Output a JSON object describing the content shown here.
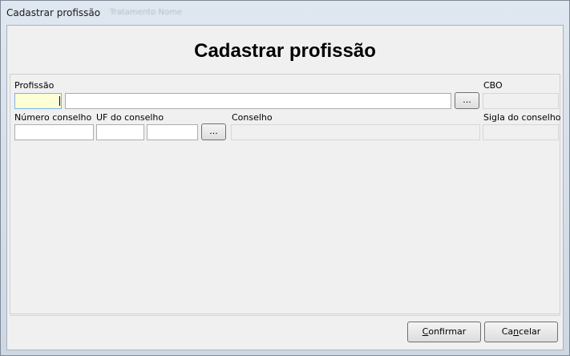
{
  "window": {
    "title": "Cadastrar profissão",
    "ghost_title": "Tratamento Nome"
  },
  "form": {
    "heading": "Cadastrar profissão",
    "profissao_label": "Profissão",
    "cbo_label": "CBO",
    "numero_conselho_label": "Número conselho",
    "uf_conselho_label": "UF do conselho",
    "conselho_label": "Conselho",
    "sigla_conselho_label": "Sigla do conselho",
    "lookup_button": "...",
    "profissao_code": "",
    "profissao_name": "",
    "cbo_value": "",
    "numero_conselho_value": "",
    "uf_code": "",
    "uf_name": "",
    "conselho_value": "",
    "sigla_value": ""
  },
  "buttons": {
    "confirmar_first": "C",
    "confirmar_rest": "onfirmar",
    "cancelar_first": "Ca",
    "cancelar_underlined": "n",
    "cancelar_rest": "celar"
  },
  "colors": {
    "focused_field": "#ffffd6",
    "field_border": "#abadb3"
  }
}
